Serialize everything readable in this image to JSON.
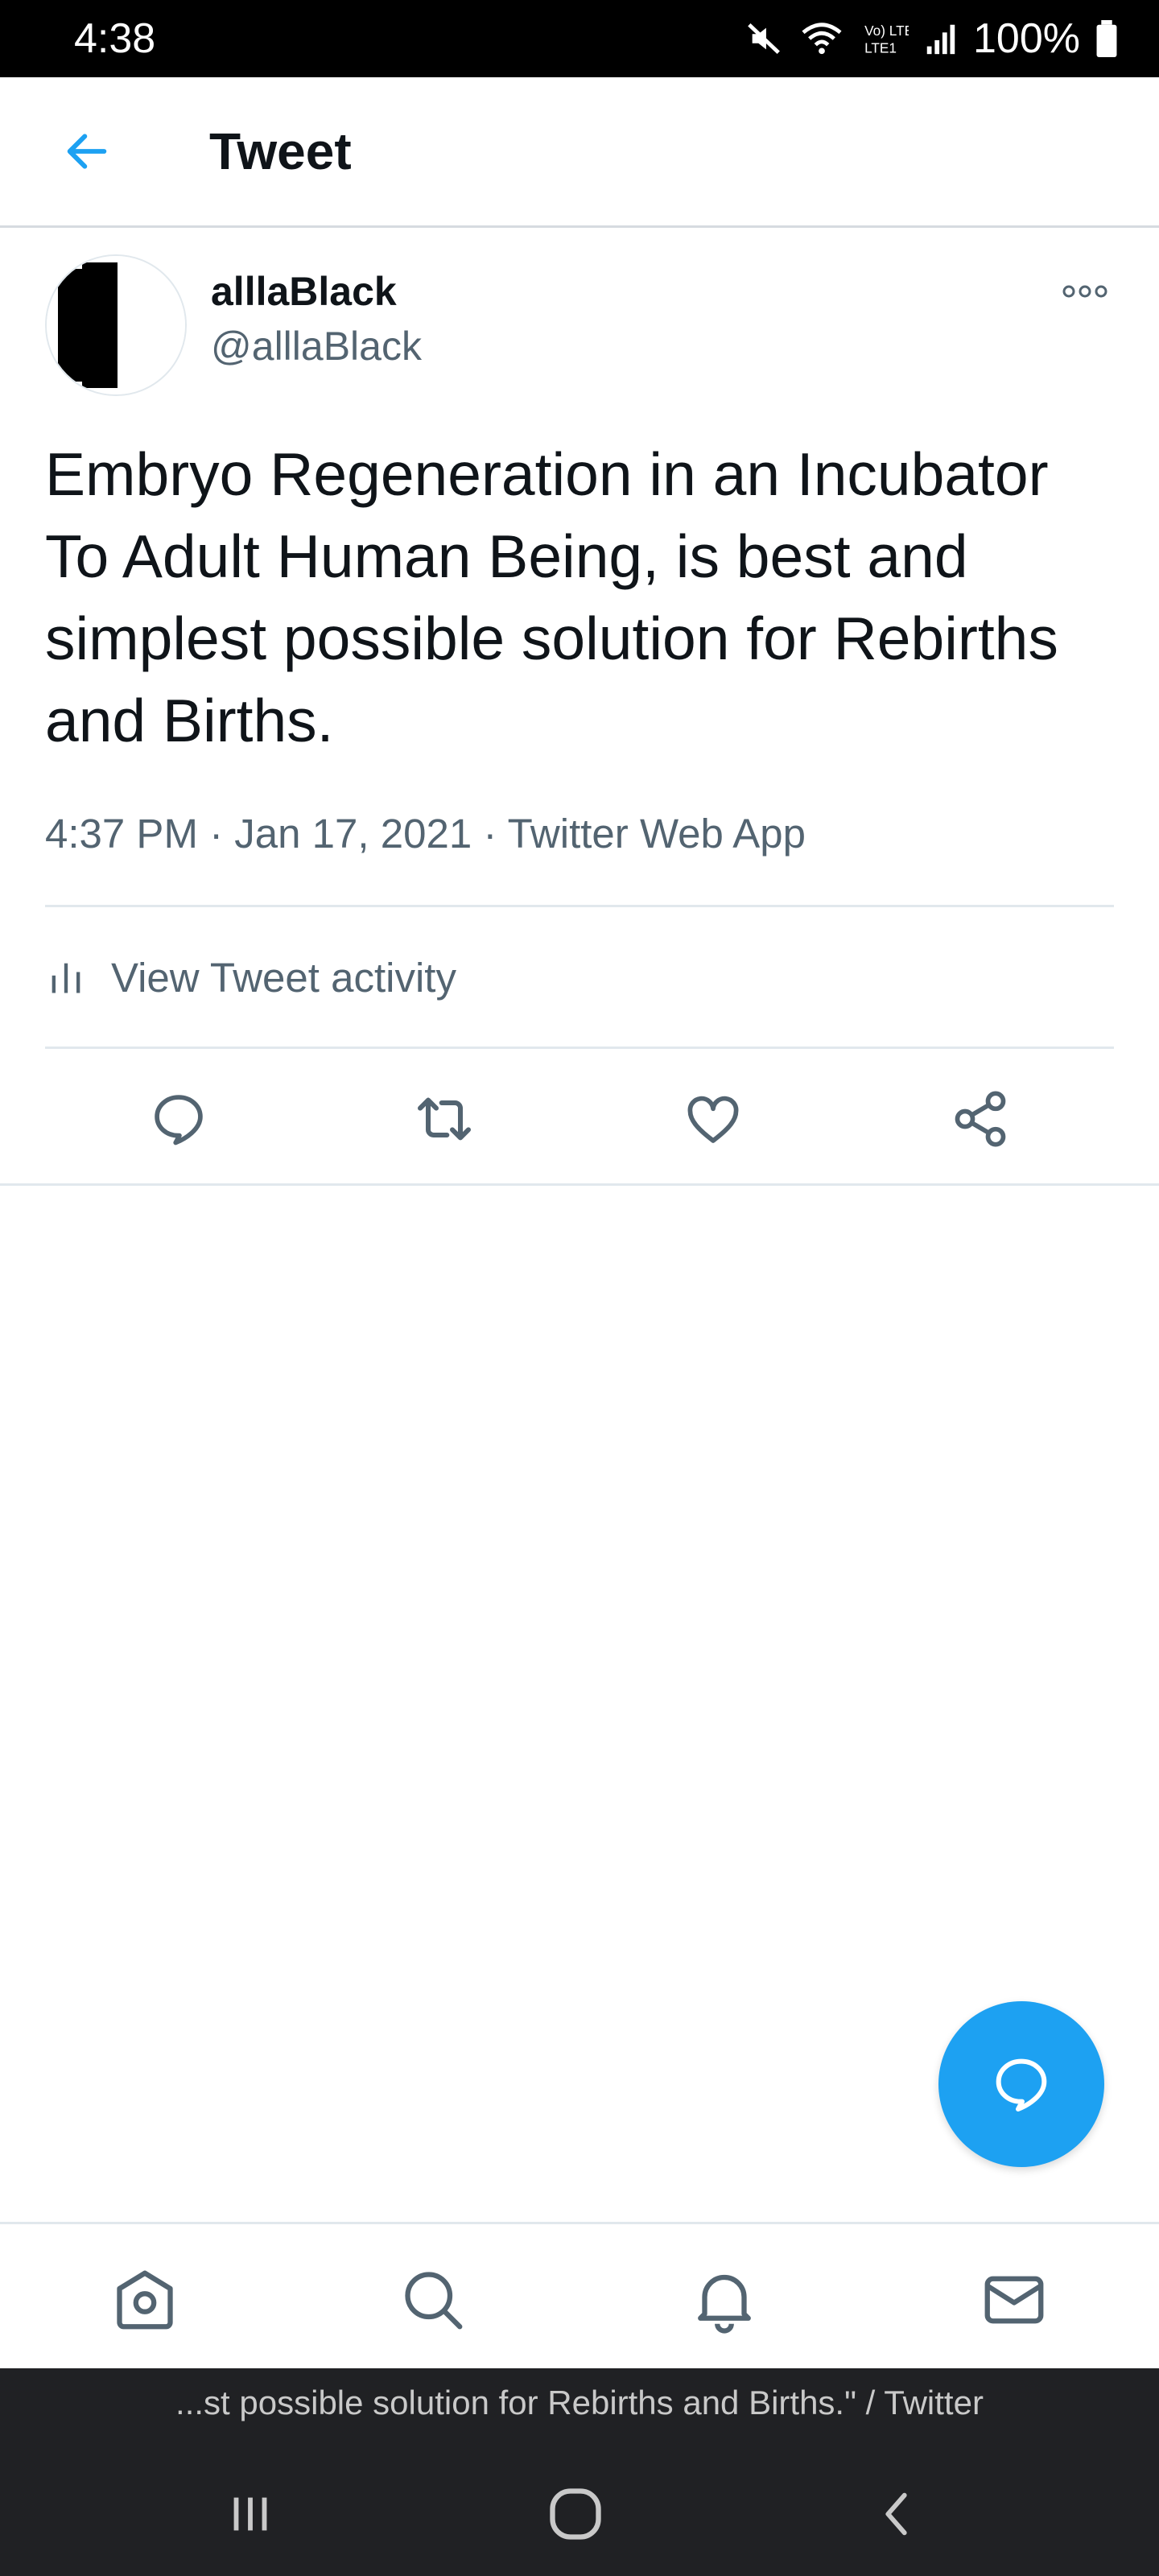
{
  "status_bar": {
    "time": "4:38",
    "battery": "100%",
    "network_label": "Vo) LTE1"
  },
  "header": {
    "title": "Tweet",
    "back_icon": "arrow-left-icon"
  },
  "tweet": {
    "display_name": "alllaBlack",
    "handle": "@alllaBlack",
    "text": "Embryo Regeneration in an Incubator To Adult Human Being, is best and simplest possible solution for Rebirths and Births.",
    "time": "4:37 PM",
    "date": "Jan 17, 2021",
    "source": "Twitter Web App",
    "separator": "·",
    "activity_label": "View Tweet activity"
  },
  "actions": [
    "reply-icon",
    "retweet-icon",
    "like-icon",
    "share-icon"
  ],
  "bottom_nav": [
    "home-icon",
    "search-icon",
    "notifications-icon",
    "messages-icon"
  ],
  "toast": {
    "text": "...st possible solution for Rebirths and Births.\" / Twitter"
  },
  "colors": {
    "accent": "#1da1f2",
    "text": "#0f1419",
    "secondary": "#536471"
  }
}
